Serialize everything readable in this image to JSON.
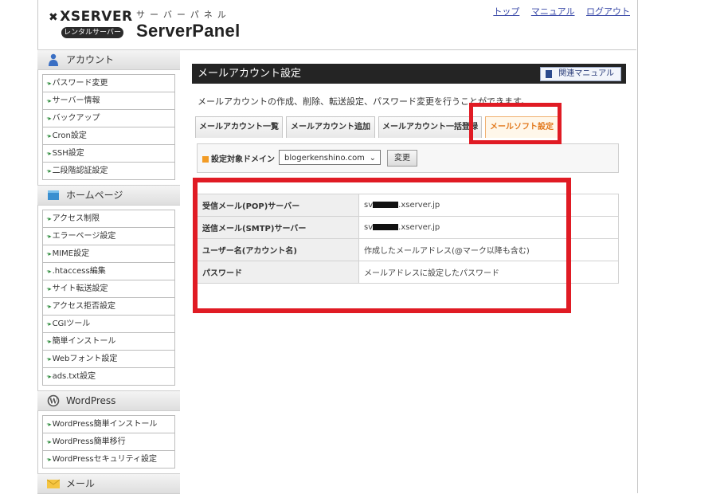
{
  "header": {
    "logo_brand": "XSERVER",
    "logo_sub": "レンタルサーバー",
    "panel_kana": "サーバーパネル",
    "panel_title": "ServerPanel",
    "links": [
      "トップ",
      "マニュアル",
      "ログアウト"
    ]
  },
  "sidebar": {
    "sections": [
      {
        "title": "アカウント",
        "icon": "person-icon",
        "items": [
          "パスワード変更",
          "サーバー情報",
          "バックアップ",
          "Cron設定",
          "SSH設定",
          "二段階認証設定"
        ]
      },
      {
        "title": "ホームページ",
        "icon": "folder-icon",
        "items": [
          "アクセス制限",
          "エラーページ設定",
          "MIME設定",
          ".htaccess編集",
          "サイト転送設定",
          "アクセス拒否設定",
          "CGIツール",
          "簡単インストール",
          "Webフォント設定",
          "ads.txt設定"
        ]
      },
      {
        "title": "WordPress",
        "icon": "wordpress-icon",
        "items": [
          "WordPress簡単インストール",
          "WordPress簡単移行",
          "WordPressセキュリティ設定"
        ]
      },
      {
        "title": "メール",
        "icon": "mail-icon",
        "items": []
      }
    ]
  },
  "main": {
    "title": "メールアカウント設定",
    "manual_button": "関連マニュアル",
    "description": "メールアカウントの作成、削除、転送設定、パスワード変更を行うことができます。",
    "tabs": [
      "メールアカウント一覧",
      "メールアカウント追加",
      "メールアカウント一括登録",
      "メールソフト設定"
    ],
    "active_tab": 3,
    "domain_label": "設定対象ドメイン",
    "domain_value": "blogerkenshino.com",
    "change_button": "変更",
    "info_rows": [
      {
        "key": "受信メール(POP)サーバー",
        "prefix": "sv",
        "suffix": ".xserver.jp"
      },
      {
        "key": "送信メール(SMTP)サーバー",
        "prefix": "sv",
        "suffix": ".xserver.jp"
      },
      {
        "key": "ユーザー名(アカウント名)",
        "value": "作成したメールアドレス(@マーク以降も含む)"
      },
      {
        "key": "パスワード",
        "value": "メールアドレスに設定したパスワード"
      }
    ]
  },
  "colors": {
    "highlight": "#e01b24",
    "active_tab_text": "#e2791d",
    "titlebar": "#242424"
  }
}
